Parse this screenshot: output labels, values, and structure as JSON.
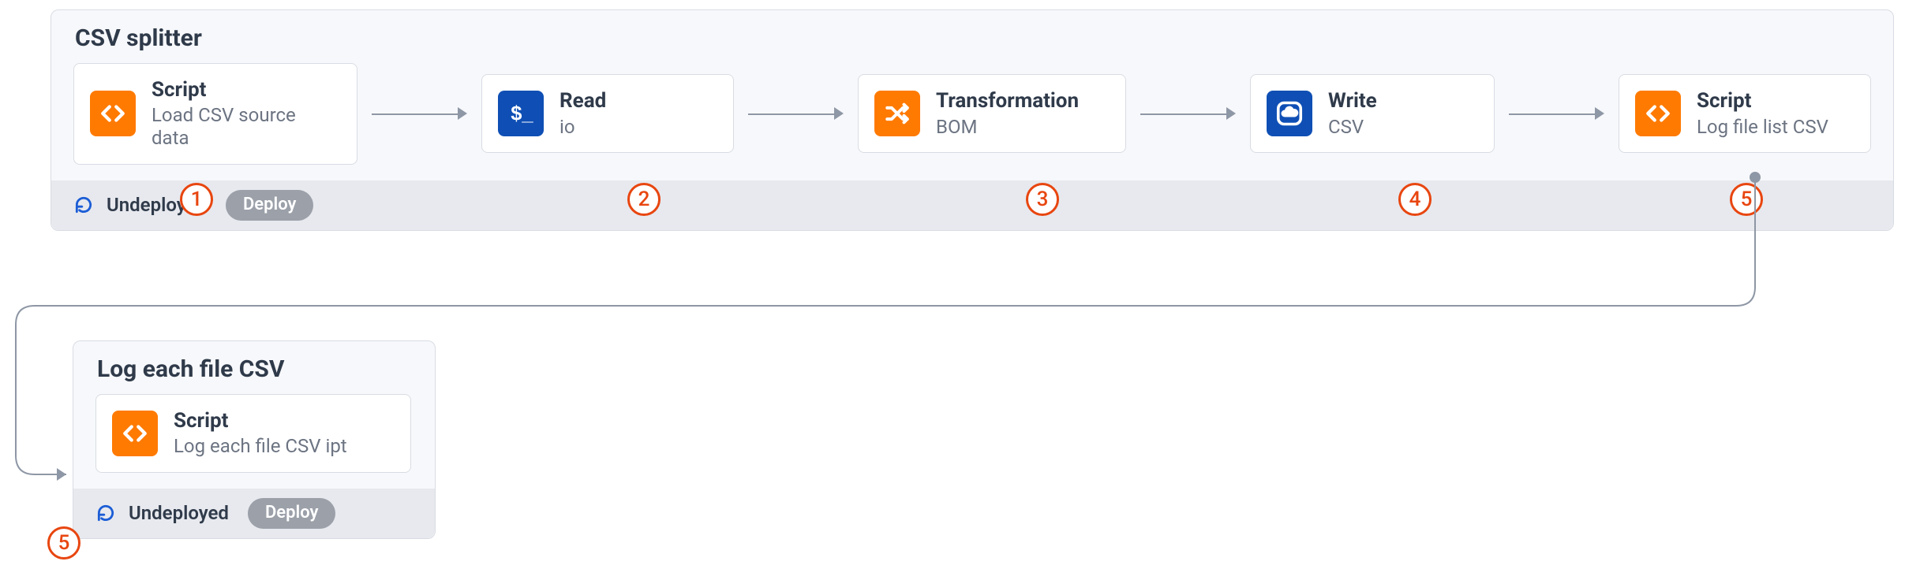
{
  "colors": {
    "orange": "#FF7A00",
    "blue": "#0F4FB5",
    "ring": "#E84610",
    "arrow": "#8E97A5"
  },
  "op1": {
    "title": "CSV splitter",
    "status": "Undeployed",
    "deploy_label": "Deploy",
    "step1": {
      "title": "Script",
      "subtitle": "Load CSV source data",
      "icon": "code-brackets-icon",
      "icon_color": "orange"
    },
    "step2": {
      "title": "Read",
      "subtitle": "io",
      "icon": "dollar-terminal-icon",
      "icon_color": "blue"
    },
    "step3": {
      "title": "Transformation",
      "subtitle": "BOM",
      "icon": "shuffle-arrows-icon",
      "icon_color": "orange"
    },
    "step4": {
      "title": "Write",
      "subtitle": "CSV",
      "icon": "cloud-icon",
      "icon_color": "blue"
    },
    "step5": {
      "title": "Script",
      "subtitle": "Log file list CSV",
      "icon": "code-brackets-icon",
      "icon_color": "orange"
    }
  },
  "op2": {
    "title": "Log each file CSV",
    "status": "Undeployed",
    "deploy_label": "Deploy",
    "step1": {
      "title": "Script",
      "subtitle": "Log each file CSV ipt",
      "icon": "code-brackets-icon",
      "icon_color": "orange"
    }
  },
  "callouts": {
    "c1": "1",
    "c2": "2",
    "c3": "3",
    "c4": "4",
    "c5a": "5",
    "c5b": "5"
  }
}
